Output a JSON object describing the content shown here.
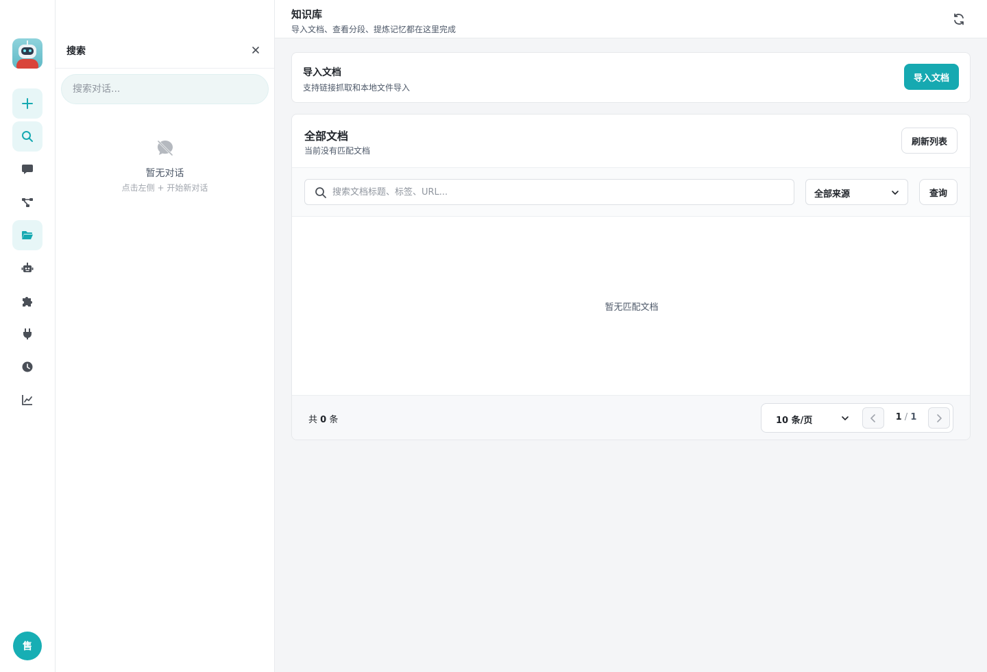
{
  "search_panel": {
    "title": "搜索",
    "placeholder": "搜索对话...",
    "empty_title": "暂无对话",
    "empty_hint": "点击左侧 + 开始新对话"
  },
  "rail": {
    "items": [
      {
        "icon": "plus-icon",
        "active": true
      },
      {
        "icon": "search-icon",
        "active": true
      },
      {
        "icon": "chat-icon",
        "active": false
      },
      {
        "icon": "workflow-icon",
        "active": false
      },
      {
        "icon": "folder-icon",
        "active": true
      },
      {
        "icon": "robot-icon",
        "active": false
      },
      {
        "icon": "puzzle-icon",
        "active": false
      },
      {
        "icon": "plug-icon",
        "active": false
      },
      {
        "icon": "clock-icon",
        "active": false
      },
      {
        "icon": "chart-icon",
        "active": false
      }
    ],
    "avatar_text": "售"
  },
  "header": {
    "title": "知识库",
    "subtitle": "导入文档、查看分段、提炼记忆都在这里完成"
  },
  "import_card": {
    "title": "导入文档",
    "subtitle": "支持链接抓取和本地文件导入",
    "button": "导入文档"
  },
  "docs_card": {
    "title": "全部文档",
    "subtitle": "当前没有匹配文档",
    "refresh_button": "刷新列表",
    "search_placeholder": "搜索文档标题、标签、URL...",
    "source_filter": "全部来源",
    "query_button": "查询",
    "empty_text": "暂无匹配文档"
  },
  "pagination": {
    "total_prefix": "共",
    "total_count": "0",
    "total_suffix": "条",
    "page_size": "10 条/页",
    "current_page": "1",
    "separator": "/",
    "total_pages": "1"
  },
  "colors": {
    "accent": "#16a9b1",
    "active_bg": "#e7f6f7"
  }
}
